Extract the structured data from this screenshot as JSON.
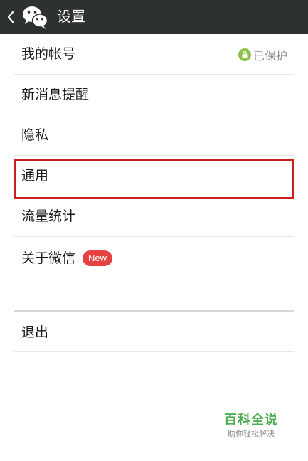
{
  "header": {
    "title": "设置"
  },
  "settings": {
    "items": [
      {
        "label": "我的帐号",
        "status": "已保护"
      },
      {
        "label": "新消息提醒"
      },
      {
        "label": "隐私"
      },
      {
        "label": "通用"
      },
      {
        "label": "流量统计"
      },
      {
        "label": "关于微信",
        "badge": "New"
      }
    ],
    "logout_label": "退出"
  },
  "watermark": {
    "title": "百科全说",
    "subtitle": "助你轻松解决"
  },
  "colors": {
    "titlebar": "#2e3132",
    "highlight_border": "#c8201f",
    "new_badge": "#e64340",
    "protected_badge": "#8bc34a",
    "watermark": "#4caf50"
  }
}
